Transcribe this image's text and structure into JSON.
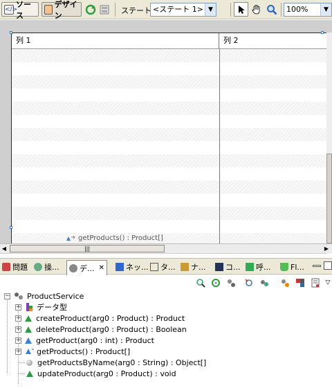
{
  "toolbar": {
    "source_label": "ソース",
    "design_label": "デザイン",
    "state_label": "ステート:",
    "state_value": "<ステート 1>",
    "zoom_value": "100%"
  },
  "grid": {
    "columns": [
      "列 1",
      "列 2"
    ],
    "binding_label": "getProducts() : Product[]"
  },
  "panel_tabs": [
    {
      "label": "問題"
    },
    {
      "label": "操..."
    },
    {
      "label": "デ..."
    },
    {
      "label": "ネッ..."
    },
    {
      "label": "タ..."
    },
    {
      "label": "ナ..."
    },
    {
      "label": "コ..."
    },
    {
      "label": "呼..."
    },
    {
      "label": "Fl..."
    }
  ],
  "tree": {
    "root": "ProductService",
    "data_types": "データ型",
    "ops": [
      "createProduct(arg0 : Product) : Product",
      "deleteProduct(arg0 : Product) : Boolean",
      "getProduct(arg0 : int) : Product",
      "getProducts() : Product[]",
      "getProductsByName(arg0 : String) : Object[]",
      "updateProduct(arg0 : Product) : void"
    ]
  },
  "icons": {
    "source": "source-code-icon",
    "design": "design-view-icon",
    "refresh": "refresh-icon",
    "pointer": "pointer-icon",
    "hand": "hand-icon",
    "zoom": "magnifier-icon"
  }
}
